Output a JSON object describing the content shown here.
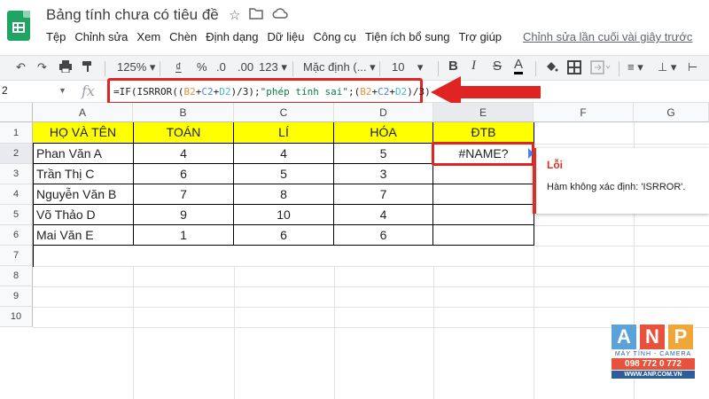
{
  "app": {
    "title": "Bảng tính chưa có tiêu đề",
    "menu": [
      "Tệp",
      "Chỉnh sửa",
      "Xem",
      "Chèn",
      "Định dạng",
      "Dữ liệu",
      "Công cụ",
      "Tiện ích bổ sung",
      "Trợ giúp"
    ],
    "last_edit": "Chỉnh sửa lần cuối vài giây trước"
  },
  "toolbar": {
    "zoom": "125%",
    "currency": "₫",
    "percent": "%",
    "dec_less": ".0",
    "dec_more": ".00",
    "format_more": "123",
    "font": "Mặc định (...",
    "font_size": "10",
    "bold": "B",
    "italic": "I",
    "strike": "S",
    "text_color": "A"
  },
  "formula_bar": {
    "name_box": "2",
    "fx": "fx",
    "formula_parts": {
      "p1": "=IF(ISRROR((",
      "b2a": "B2",
      "plus1": "+",
      "c2a": "C2",
      "plus2": "+",
      "d2a": "D2",
      "p2": ")/3);",
      "str": "\"phép tính sai\"",
      "p3": ";(",
      "b2b": "B2",
      "plus3": "+",
      "c2b": "C2",
      "plus4": "+",
      "d2b": "D2",
      "p4": ")/3)"
    }
  },
  "sheet": {
    "columns": [
      "A",
      "B",
      "C",
      "D",
      "E",
      "F",
      "G"
    ],
    "rows": [
      "1",
      "2",
      "3",
      "4",
      "5",
      "6",
      "7",
      "8",
      "9",
      "10"
    ],
    "headers": [
      "HỌ VÀ TÊN",
      "TOÁN",
      "LÍ",
      "HÓA",
      "ĐTB"
    ],
    "data": [
      {
        "name": "Phan Văn A",
        "toan": "4",
        "li": "4",
        "hoa": "5",
        "dtb": "#NAME?"
      },
      {
        "name": "Trần Thị C",
        "toan": "6",
        "li": "5",
        "hoa": "3",
        "dtb": ""
      },
      {
        "name": "Nguyễn Văn B",
        "toan": "7",
        "li": "8",
        "hoa": "7",
        "dtb": ""
      },
      {
        "name": "Võ Thảo D",
        "toan": "9",
        "li": "10",
        "hoa": "4",
        "dtb": ""
      },
      {
        "name": "Mai Văn E",
        "toan": "1",
        "li": "6",
        "hoa": "6",
        "dtb": ""
      }
    ]
  },
  "error_popup": {
    "title": "Lỗi",
    "message": "Hàm không xác định: 'ISRROR'."
  },
  "watermark": {
    "letters": [
      "A",
      "N",
      "P"
    ],
    "sub": "MÁY TÍNH - CAMERA",
    "phone": "098 772 0 772",
    "web": "WWW.ANP.COM.VN"
  },
  "colors": {
    "highlight": "#e02424",
    "header_fill": "#ffff00",
    "sheets_green": "#1fa463"
  }
}
